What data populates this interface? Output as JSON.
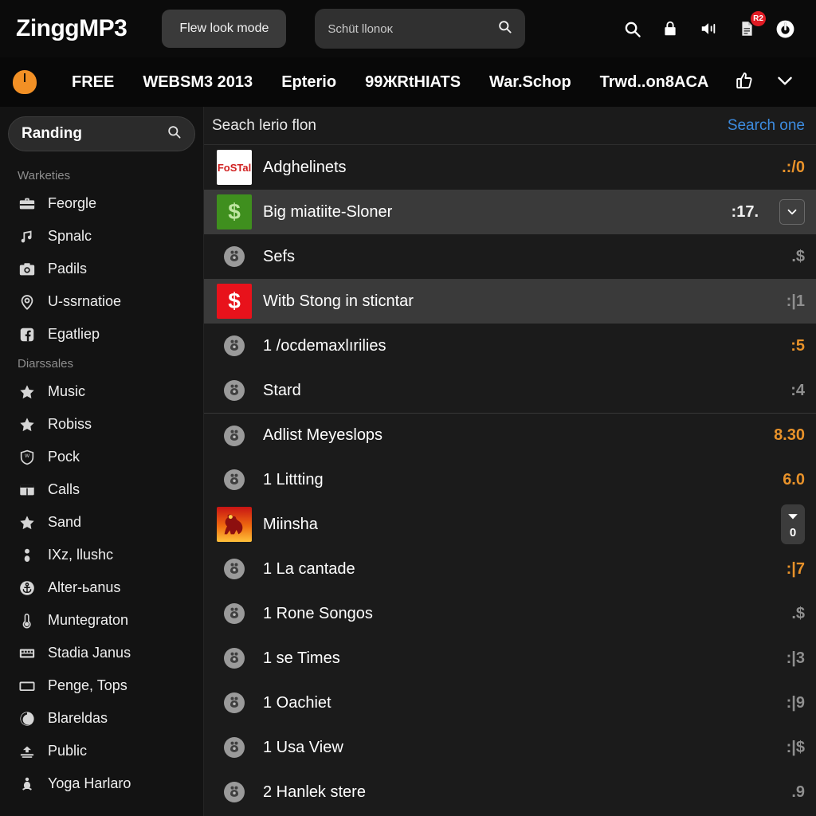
{
  "topbar": {
    "brand": "ZinggMP3",
    "mode_button": "Flew look mode",
    "search_value": "Schüt llonoĸ",
    "search_icon": "search-icon",
    "icons": [
      {
        "name": "search-icon",
        "glyph": "search"
      },
      {
        "name": "lock-icon",
        "glyph": "lock"
      },
      {
        "name": "volume-icon",
        "glyph": "volume"
      },
      {
        "name": "document-icon",
        "glyph": "document",
        "badge": "R2"
      },
      {
        "name": "power-icon",
        "glyph": "power"
      }
    ]
  },
  "navbar": {
    "logo_icon": "orange-dot-icon",
    "items": [
      "FREE",
      "WEBSM3 2013",
      "Epterio",
      "99ЖRtHIATS",
      "War.Schop",
      "Trwd..on8ACA"
    ],
    "right_icons": [
      "thumb-up-icon",
      "chevron-down-icon"
    ]
  },
  "sidebar": {
    "search_label": "Randing",
    "search_icon": "search-icon",
    "groups": [
      {
        "heading": "Warketies",
        "items": [
          {
            "label": "Feorgle",
            "icon": "briefcase-icon"
          },
          {
            "label": "Spnalc",
            "icon": "music-note-icon"
          },
          {
            "label": "Padils",
            "icon": "camera-icon"
          },
          {
            "label": "U-ssrnatioe",
            "icon": "location-pin-icon"
          },
          {
            "label": "Egatliep",
            "icon": "facebook-icon"
          }
        ]
      },
      {
        "heading": "Diarssales",
        "items": [
          {
            "label": "Music",
            "icon": "star-icon"
          },
          {
            "label": "Robiss",
            "icon": "star-icon"
          },
          {
            "label": "Pock",
            "icon": "shield-icon"
          },
          {
            "label": "Calls",
            "icon": "window-icon"
          },
          {
            "label": "Sand",
            "icon": "star-icon"
          },
          {
            "label": "IXz, llushc",
            "icon": "pin-icon"
          },
          {
            "label": "Alter-ьanus",
            "icon": "anchor-icon"
          },
          {
            "label": "Muntegraton",
            "icon": "thermometer-icon"
          },
          {
            "label": "Stadia Janus",
            "icon": "keyboard-icon"
          },
          {
            "label": "Penge, Tops",
            "icon": "rectangle-icon"
          },
          {
            "label": "Blareldas",
            "icon": "moon-icon"
          },
          {
            "label": "Public",
            "icon": "upload-icon"
          },
          {
            "label": "Yoga Harlaro",
            "icon": "lotus-icon"
          }
        ]
      }
    ]
  },
  "main": {
    "header_title": "Seach lerio flon",
    "header_action": "Search one",
    "rows": [
      {
        "label": "Adghelinets",
        "value": ".:/0",
        "value_color": "orange",
        "thumb": "postal-logo-thumb",
        "thumb_type": "image",
        "thumb_bg": "#ffffff",
        "thumb_fg": "#d02020",
        "thumb_text": "FoSTal",
        "highlight": false,
        "separator": false,
        "widget": "none"
      },
      {
        "label": "Big miatiite-Sloner",
        "value": ":17.",
        "value_color": "white",
        "thumb": "green-dollar-thumb",
        "thumb_type": "image",
        "thumb_bg": "#3f8f1e",
        "thumb_fg": "#bfe6a2",
        "thumb_text": "$",
        "highlight": true,
        "separator": false,
        "widget": "chevron"
      },
      {
        "label": "Sefs",
        "value": ".$",
        "value_color": "grey",
        "thumb": "user-avatar",
        "thumb_type": "avatar",
        "highlight": false,
        "separator": false,
        "widget": "none"
      },
      {
        "label": "Witb Stong in sticntar",
        "value": ":|1",
        "value_color": "grey",
        "thumb": "red-dollar-thumb",
        "thumb_type": "image",
        "thumb_bg": "#e8121b",
        "thumb_fg": "#ffffff",
        "thumb_text": "$",
        "highlight": true,
        "separator": false,
        "widget": "none"
      },
      {
        "label": "1 /ocdemaxlırilies",
        "value": ":5",
        "value_color": "orange",
        "thumb": "user-avatar",
        "thumb_type": "avatar",
        "highlight": false,
        "separator": false,
        "widget": "none"
      },
      {
        "label": "Stard",
        "value": ":4",
        "value_color": "grey",
        "thumb": "user-avatar",
        "thumb_type": "avatar",
        "highlight": false,
        "separator": false,
        "widget": "none"
      },
      {
        "label": "Adlist Meyeslops",
        "value": "8.30",
        "value_color": "orange",
        "thumb": "user-avatar",
        "thumb_type": "avatar",
        "highlight": false,
        "separator": true,
        "widget": "none"
      },
      {
        "label": "1 Littting",
        "value": "6.0",
        "value_color": "orange",
        "thumb": "user-avatar",
        "thumb_type": "avatar",
        "highlight": false,
        "separator": false,
        "widget": "none"
      },
      {
        "label": "Miinsha",
        "value": "",
        "value_color": "grey",
        "thumb": "rooster-thumb",
        "thumb_type": "image",
        "thumb_bg": "#f07a12",
        "thumb_fg": "#a81414",
        "thumb_text": "",
        "highlight": false,
        "separator": false,
        "widget": "stepper",
        "stepper_value": "0"
      },
      {
        "label": "1 La cantade",
        "value": ":|7",
        "value_color": "orange",
        "thumb": "user-avatar",
        "thumb_type": "avatar",
        "highlight": false,
        "separator": false,
        "widget": "none"
      },
      {
        "label": "1 Rone Songos",
        "value": ".$",
        "value_color": "grey",
        "thumb": "user-avatar",
        "thumb_type": "avatar",
        "highlight": false,
        "separator": false,
        "widget": "none"
      },
      {
        "label": "1 se Times",
        "value": ":|3",
        "value_color": "grey",
        "thumb": "user-avatar",
        "thumb_type": "avatar",
        "highlight": false,
        "separator": false,
        "widget": "none"
      },
      {
        "label": "1 Oachiet",
        "value": ":|9",
        "value_color": "grey",
        "thumb": "user-avatar",
        "thumb_type": "avatar",
        "highlight": false,
        "separator": false,
        "widget": "none"
      },
      {
        "label": "1 Usa View",
        "value": ":|$",
        "value_color": "grey",
        "thumb": "user-avatar",
        "thumb_type": "avatar",
        "highlight": false,
        "separator": false,
        "widget": "none"
      },
      {
        "label": "2 Hanlek stere",
        "value": ".9",
        "value_color": "grey",
        "thumb": "user-avatar",
        "thumb_type": "avatar",
        "highlight": false,
        "separator": false,
        "widget": "none"
      }
    ]
  },
  "colors": {
    "accent_orange": "#e8922a",
    "link_blue": "#3d8ce0",
    "badge_red": "#e01b24",
    "nav_dot": "#f29025"
  }
}
